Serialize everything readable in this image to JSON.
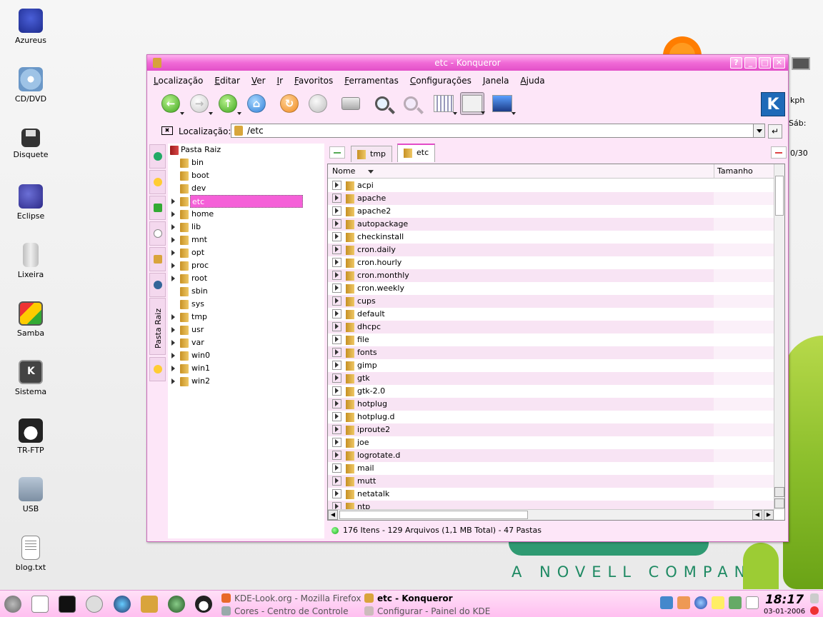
{
  "desktop": {
    "icons": [
      {
        "label": "Azureus",
        "icon": "azureus-icon"
      },
      {
        "label": "CD/DVD",
        "icon": "cdrom-icon"
      },
      {
        "label": "Disquete",
        "icon": "floppy-icon"
      },
      {
        "label": "Eclipse",
        "icon": "eclipse-icon"
      },
      {
        "label": "Lixeira",
        "icon": "trash-icon"
      },
      {
        "label": "Samba",
        "icon": "samba-icon"
      },
      {
        "label": "Sistema",
        "icon": "system-icon"
      },
      {
        "label": "TR-FTP",
        "icon": "tux-icon"
      },
      {
        "label": "USB",
        "icon": "usb-icon"
      },
      {
        "label": "blog.txt",
        "icon": "text-file-icon"
      }
    ],
    "edge_texts": [
      "kph",
      "Sáb:",
      "0/30"
    ],
    "wallpaper_text": "A NOVELL COMPANY"
  },
  "window": {
    "title": "etc - Konqueror",
    "title_buttons": [
      "?",
      "_",
      "□",
      "✕"
    ],
    "menu": [
      "Localização",
      "Editar",
      "Ver",
      "Ir",
      "Favoritos",
      "Ferramentas",
      "Configurações",
      "Janela",
      "Ajuda"
    ],
    "location": {
      "label": "Localização:",
      "value": "/etc",
      "go_glyph": "↵"
    },
    "sidebar_tab_label": "Pasta Raiz",
    "tree": {
      "root": "Pasta Raiz",
      "items": [
        {
          "name": "bin",
          "expandable": false
        },
        {
          "name": "boot",
          "expandable": false
        },
        {
          "name": "dev",
          "expandable": false
        },
        {
          "name": "etc",
          "expandable": true,
          "selected": true
        },
        {
          "name": "home",
          "expandable": true
        },
        {
          "name": "lib",
          "expandable": true
        },
        {
          "name": "mnt",
          "expandable": true
        },
        {
          "name": "opt",
          "expandable": true
        },
        {
          "name": "proc",
          "expandable": true
        },
        {
          "name": "root",
          "expandable": true
        },
        {
          "name": "sbin",
          "expandable": false
        },
        {
          "name": "sys",
          "expandable": false
        },
        {
          "name": "tmp",
          "expandable": true
        },
        {
          "name": "usr",
          "expandable": true
        },
        {
          "name": "var",
          "expandable": true
        },
        {
          "name": "win0",
          "expandable": true
        },
        {
          "name": "win1",
          "expandable": true
        },
        {
          "name": "win2",
          "expandable": true
        }
      ]
    },
    "tabs": [
      {
        "label": "tmp",
        "active": false
      },
      {
        "label": "etc",
        "active": true
      }
    ],
    "columns": [
      "Nome",
      "Tamanho"
    ],
    "files": [
      "acpi",
      "apache",
      "apache2",
      "autopackage",
      "checkinstall",
      "cron.daily",
      "cron.hourly",
      "cron.monthly",
      "cron.weekly",
      "cups",
      "default",
      "dhcpc",
      "file",
      "fonts",
      "gimp",
      "gtk",
      "gtk-2.0",
      "hotplug",
      "hotplug.d",
      "iproute2",
      "joe",
      "logrotate.d",
      "mail",
      "mutt",
      "netatalk",
      "ntp"
    ],
    "status": "176 Itens - 129 Arquivos (1,1 MB Total) - 47 Pastas"
  },
  "taskbar": {
    "tasks": [
      {
        "label": "KDE-Look.org - Mozilla Firefox",
        "active": false,
        "icon": "firefox-icon"
      },
      {
        "label": "etc - Konqueror",
        "active": true,
        "icon": "folder-icon"
      },
      {
        "label": "Cores - Centro de Controle",
        "active": false,
        "icon": "control-center-icon"
      },
      {
        "label": "Configurar - Painel do KDE",
        "active": false,
        "icon": "panel-config-icon"
      }
    ],
    "clock_time": "18:17",
    "clock_date": "03-01-2006"
  },
  "colors": {
    "title_accent": "#e250c8",
    "selection": "#f560d8",
    "window_bg": "#fde6f8"
  }
}
